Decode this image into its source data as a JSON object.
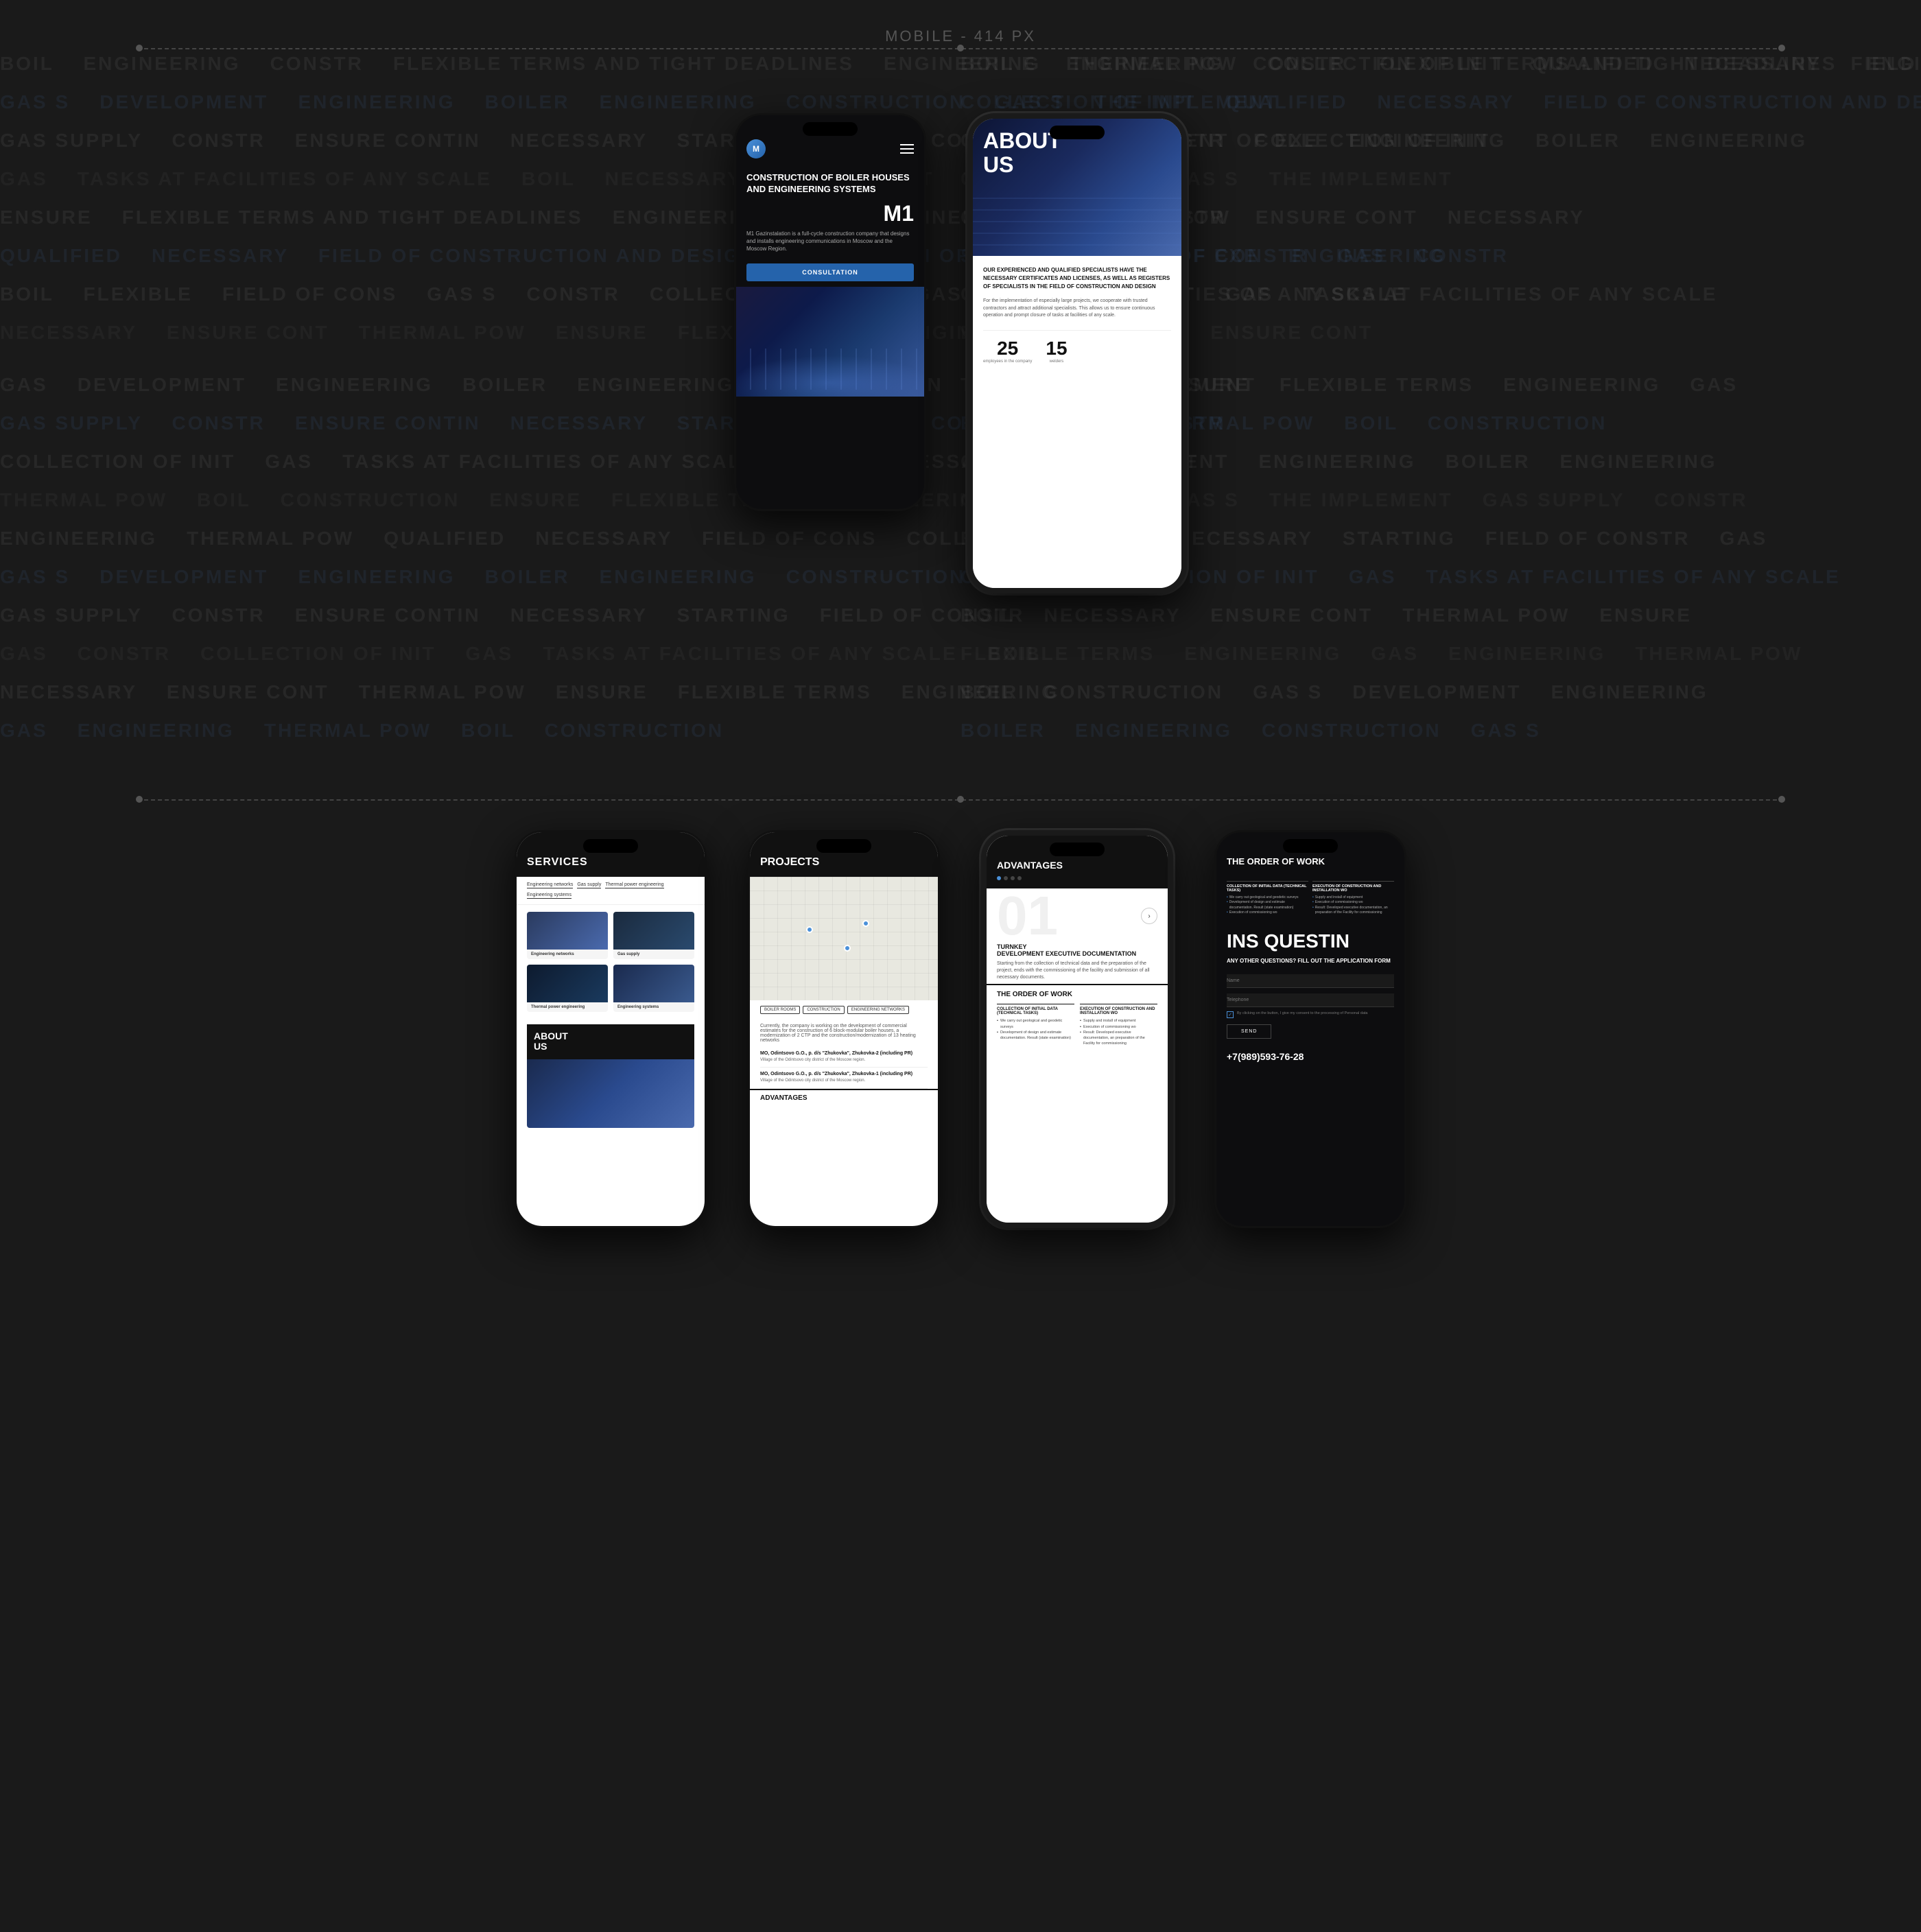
{
  "header": {
    "label": "MOBILE - 414 PX"
  },
  "bg_text_rows": [
    "BOILER  ENGINEERING  CONSTR  FLEXIBLE TERMS AND TIGHT DEADLINES  ENGINEERING  THERMAL POW",
    "COLLECTION OF INIT  QUALIFIED  NECESSARY  FIELD OF CONS",
    "GAS S  DEVELOPMENT  ENGINEERING  BOILER  ENGINEERING",
    "CONSTRUCTION  GAS S  THE IMPLEMENT",
    "GAS SUPPLY  CONSTR  ENSURE CONTIN  NECESSARY",
    "STARTING  FIELD OF CONSTR  GAS  CONSTR",
    "COLLECTION OF INIT  GAS  TASKS AT FACILITIES OF ANY SCALE  BOIL",
    "NECESSARY  ENSURE CONT",
    "THERMAL POW  ENSURE  FLEXIBLE TERMS  ENGINEERING  GAS",
    "ENGINEERING  THERMAL POW",
    "QUALIFIED  NECESSARY  FIELD OF CONS  COLLECTION OF  DEVELOPMENT O  ENGINEERING",
    "BOIL  FLEXIBLE  FIELD OF CONS"
  ],
  "phone1": {
    "logo_text": "M1",
    "title": "CONSTRUCTION OF BOILER HOUSES AND ENGINEERING SYSTEMS",
    "big_letter": "M1",
    "description": "M1 Gazinstalation is a full-cycle construction company that designs and installs engineering communications in Moscow and the Moscow Region.",
    "btn_label": "CONSULTATION"
  },
  "phone2": {
    "title": "ABOUT\nUS",
    "subtitle": "OUR EXPERIENCED AND QUALIFIED SPECIALISTS HAVE THE NECESSARY CERTIFICATES AND LICENSES, AS WELL AS REGISTERS OF SPECIALISTS IN THE FIELD OF CONSTRUCTION AND DESIGN",
    "body_text": "For the implementation of especially large projects, we cooperate with trusted contractors and attract additional specialists. This allows us to ensure continuous operation and prompt closure of tasks at facilities of any scale.",
    "stat1_num": "25",
    "stat1_label": "employees in the company",
    "stat2_num": "15",
    "stat2_label": "welders"
  },
  "phone3": {
    "title": "SERVICES",
    "categories": [
      "Engineering networks",
      "Gas supply",
      "Thermal power engineering",
      "Engineering systems"
    ],
    "about_text": "ABOUT\nUS"
  },
  "phone4": {
    "title": "PROJECTS",
    "tags": [
      "BOILER ROOMS",
      "CONSTRUCTION",
      "ENGINEERING NETWORKS"
    ],
    "body_text": "Currently, the company is working on the development of commercial estimates for the construction of 6 block-modular boiler houses, a modernization of 2 CTP and the construction/modernization of 13 heating networks",
    "projects": [
      {
        "name": "MO, Odintsovo G.O., p. d/s \"Zhukovka\", Zhukovka-2 (including PR)",
        "desc": "Village of the Odintsovo city district of the Moscow region."
      },
      {
        "name": "MO, Odintsovo G.O., p. d/s \"Zhukovka\", Zhukovka-1 (including PR)",
        "desc": "Village of the Odintsovo city district of the Moscow region."
      }
    ],
    "advantages_label": "ADVANTAGES"
  },
  "phone5": {
    "title": "ADVANTAGES",
    "big_num": "01",
    "adv_title": "Development executive documentation",
    "adv_subtitle": "Turnkey",
    "adv_text": "Starting from the collection of technical data and the preparation of the project, ends with the commissioning of the facility and submission of all necessary documents.",
    "order_title": "THE ORDER OF WORK",
    "col1_title": "COLLECTION OF INITIAL DATA (TECHNICAL TASKS)",
    "col1_items": [
      "We carry out geological and geodetic surveys",
      "Development of design and estimate documentation. Result (state examination)"
    ],
    "col2_title": "EXECUTION OF CONSTRUCTION AND INSTALLATION WO",
    "col2_items": [
      "Supply and install of equipment",
      "Execution of commissioning wo",
      "Result: Developed executive documentation, an preparation of the Facility for commissioning"
    ]
  },
  "phone6": {
    "title": "THE ORDER OF WORK",
    "col1_title": "COLLECTION OF INITIAL DATA (TECHNICAL TASKS)",
    "col1_items": [
      "We carry out geological and geodetic surveys",
      "Development of design and estimate documentation. Result (state examination)"
    ],
    "col2_title": "EXECUTION OF CONSTRUCTION AND INSTALLATION WO",
    "col2_items": [
      "Supply and install of equipment",
      "Execution of commissioning wo",
      "Result: Developed executive documentation, an preparation of the Facility for commissioning"
    ],
    "big_text": "INS QUESTIN",
    "question_text": "ANY OTHER QUESTIONS? FILL OUT THE APPLICATION FORM",
    "input1_placeholder": "Name",
    "input2_placeholder": "Telephone",
    "checkbox_text": "By clicking on the button, I give my consent to the processing of Personal data",
    "send_label": "SEND",
    "phone_number": "+7(989)593-76-28"
  }
}
